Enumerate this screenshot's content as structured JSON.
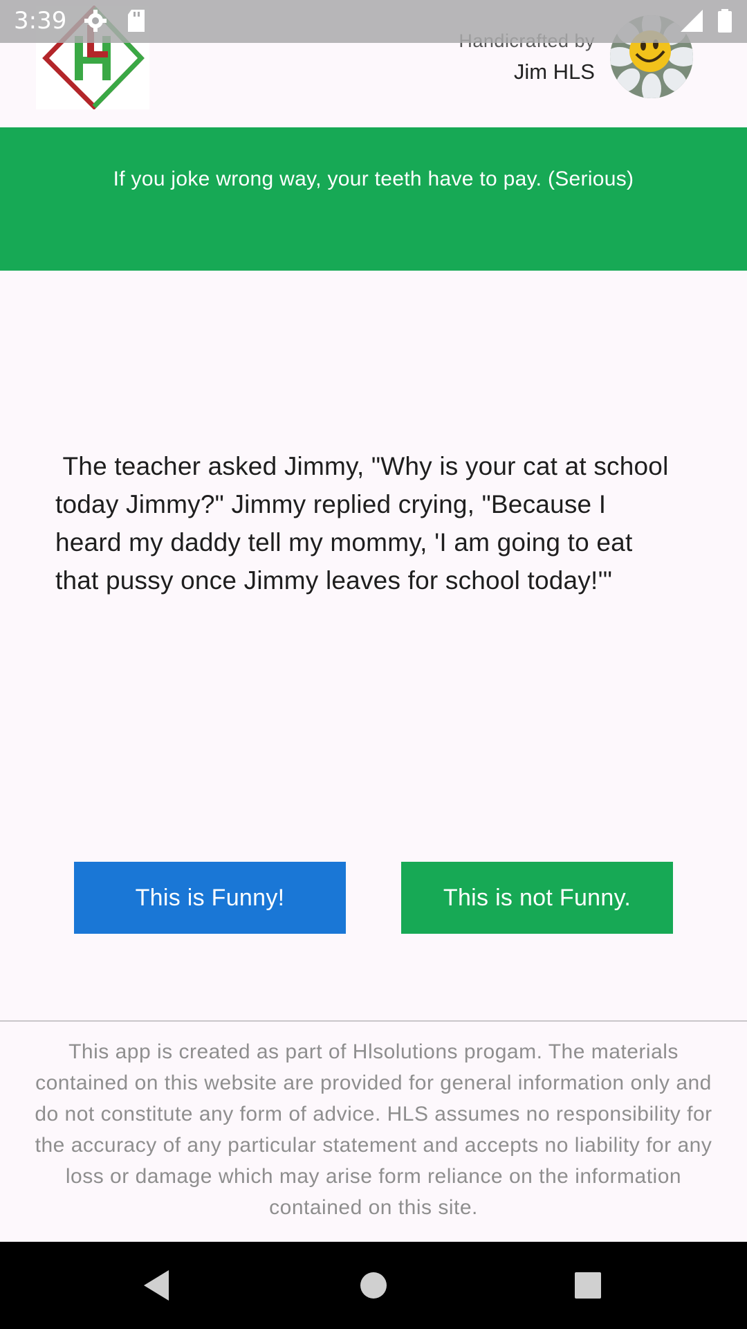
{
  "status_bar": {
    "time": "3:39",
    "icons": [
      "settings-icon",
      "sd-card-icon",
      "signal-icon",
      "battery-icon"
    ]
  },
  "header": {
    "logo_icon": "hl-diamond-logo",
    "credit_label": "Handicrafted by",
    "credit_name": "Jim HLS",
    "avatar_icon": "smiley-flower-avatar"
  },
  "banner": {
    "text": "If you joke wrong way, your teeth have to pay. (Serious)"
  },
  "joke": {
    "text": " The teacher asked Jimmy, \"Why is your cat at school today Jimmy?\" Jimmy replied crying, \"Because I heard my daddy tell my mommy, 'I am going to eat that pussy once Jimmy leaves for school today!'\""
  },
  "buttons": {
    "funny": "This is Funny!",
    "not_funny": "This is not Funny."
  },
  "footer": {
    "disclaimer": "This app is created as part of Hlsolutions progam. The materials contained on this website are provided for general information only and do not constitute any form of advice. HLS assumes no responsibility for the accuracy of any particular statement and accepts no liability for any loss or damage which may arise form reliance on the information contained on this site."
  },
  "nav_bar": {
    "icons": [
      "back-icon",
      "home-icon",
      "recents-icon"
    ]
  },
  "colors": {
    "green": "#17a955",
    "blue": "#1a77d6",
    "background": "#fdf8fc"
  }
}
